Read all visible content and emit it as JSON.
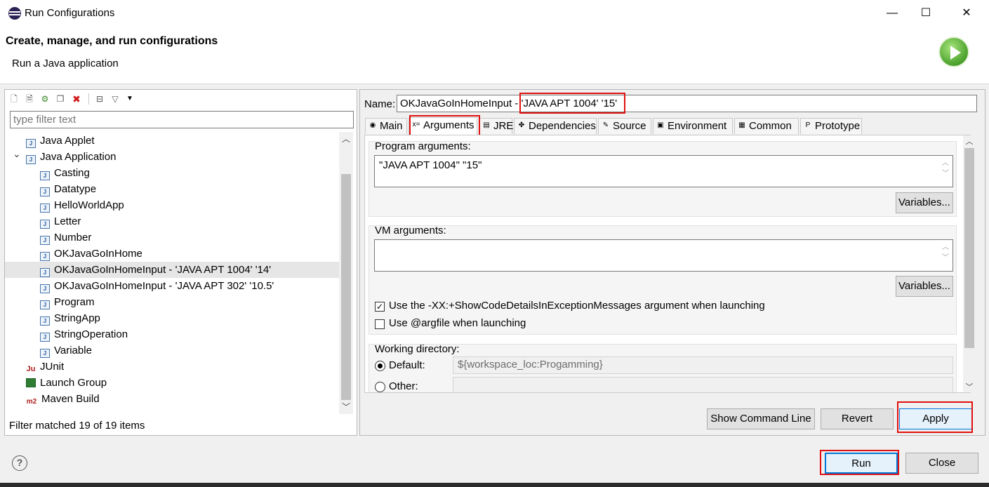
{
  "window": {
    "title": "Run Configurations",
    "minimize": "—",
    "maximize": "☐",
    "close": "✕"
  },
  "header": {
    "title": "Create, manage, and run configurations",
    "subtitle": "Run a Java application"
  },
  "left": {
    "filter_placeholder": "type filter text",
    "tree": [
      {
        "label": "Java Applet",
        "level": 1,
        "icon": "applet-icon",
        "expandable": false
      },
      {
        "label": "Java Application",
        "level": 1,
        "icon": "java-app-icon",
        "expandable": true,
        "expanded": true
      },
      {
        "label": "Casting",
        "level": 2,
        "icon": "java-config-icon"
      },
      {
        "label": "Datatype",
        "level": 2,
        "icon": "java-config-icon"
      },
      {
        "label": "HelloWorldApp",
        "level": 2,
        "icon": "java-config-icon"
      },
      {
        "label": "Letter",
        "level": 2,
        "icon": "java-config-icon"
      },
      {
        "label": "Number",
        "level": 2,
        "icon": "java-config-icon"
      },
      {
        "label": "OKJavaGoInHome",
        "level": 2,
        "icon": "java-config-icon"
      },
      {
        "label": "OKJavaGoInHomeInput - 'JAVA APT 1004' '14'",
        "level": 2,
        "icon": "java-config-icon",
        "selected": true
      },
      {
        "label": "OKJavaGoInHomeInput - 'JAVA APT 302' '10.5'",
        "level": 2,
        "icon": "java-config-icon"
      },
      {
        "label": "Program",
        "level": 2,
        "icon": "java-config-icon"
      },
      {
        "label": "StringApp",
        "level": 2,
        "icon": "java-config-icon"
      },
      {
        "label": "StringOperation",
        "level": 2,
        "icon": "java-config-icon"
      },
      {
        "label": "Variable",
        "level": 2,
        "icon": "java-config-icon"
      },
      {
        "label": "JUnit",
        "level": 1,
        "icon": "junit-icon"
      },
      {
        "label": "Launch Group",
        "level": 1,
        "icon": "launch-group-icon"
      },
      {
        "label": "Maven Build",
        "level": 1,
        "icon": "maven-icon"
      }
    ],
    "status": "Filter matched 19 of 19 items"
  },
  "right": {
    "name_label": "Name:",
    "name_value": "OKJavaGoInHomeInput - 'JAVA APT 1004' '15'",
    "tabs": [
      {
        "label": "Main",
        "icon": "main-tab-icon",
        "glyph": "◉"
      },
      {
        "label": "Arguments",
        "icon": "arguments-tab-icon",
        "glyph": "x=",
        "active": true
      },
      {
        "label": "JRE",
        "icon": "jre-tab-icon",
        "glyph": "▤"
      },
      {
        "label": "Dependencies",
        "icon": "dependencies-tab-icon",
        "glyph": "✤"
      },
      {
        "label": "Source",
        "icon": "source-tab-icon",
        "glyph": "✎"
      },
      {
        "label": "Environment",
        "icon": "environment-tab-icon",
        "glyph": "▣"
      },
      {
        "label": "Common",
        "icon": "common-tab-icon",
        "glyph": "▦"
      },
      {
        "label": "Prototype",
        "icon": "prototype-tab-icon",
        "glyph": "P"
      }
    ],
    "program_args_label": "Program arguments:",
    "program_args_value": "\"JAVA APT 1004\" \"15\"",
    "variables_label": "Variables...",
    "vm_args_label": "VM arguments:",
    "vm_args_value": "",
    "vm_variables_label": "Variables...",
    "show_code_details_label": "Use the -XX:+ShowCodeDetailsInExceptionMessages argument when launching",
    "show_code_details_checked": true,
    "argfile_label": "Use @argfile when launching",
    "argfile_checked": false,
    "working_dir_label": "Working directory:",
    "default_label": "Default:",
    "default_value": "${workspace_loc:Progamming}",
    "other_label": "Other:",
    "show_command_line": "Show Command Line",
    "revert": "Revert",
    "apply": "Apply"
  },
  "footer": {
    "help": "?",
    "run": "Run",
    "close": "Close"
  }
}
